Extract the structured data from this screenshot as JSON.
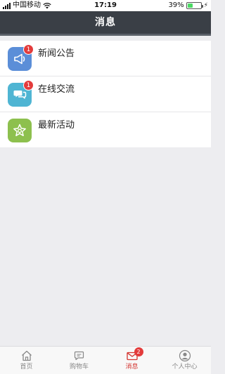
{
  "status_bar": {
    "carrier": "中国移动",
    "time": "17:19",
    "battery_percent": "39%",
    "battery_level": 0.39,
    "battery_color": "#4cd964"
  },
  "header": {
    "title": "消息",
    "background": "#3a3f46"
  },
  "list": {
    "items": [
      {
        "label": "新闻公告",
        "badge": "1",
        "icon": "megaphone-icon",
        "icon_color": "#5b8ed8"
      },
      {
        "label": "在线交流",
        "badge": "1",
        "icon": "chat-bubble-icon",
        "icon_color": "#4fb5d3"
      },
      {
        "label": "最新活动",
        "badge": "",
        "icon": "star-icon",
        "icon_color": "#8dc04e"
      }
    ]
  },
  "tab_bar": {
    "tabs": [
      {
        "label": "首页",
        "icon": "home-icon",
        "active": false,
        "badge": ""
      },
      {
        "label": "购物车",
        "icon": "cart-icon",
        "active": false,
        "badge": ""
      },
      {
        "label": "消息",
        "icon": "mail-icon",
        "active": true,
        "badge": "2"
      },
      {
        "label": "个人中心",
        "icon": "user-icon",
        "active": false,
        "badge": ""
      }
    ],
    "active_color": "#d3332e",
    "inactive_color": "#888888"
  }
}
